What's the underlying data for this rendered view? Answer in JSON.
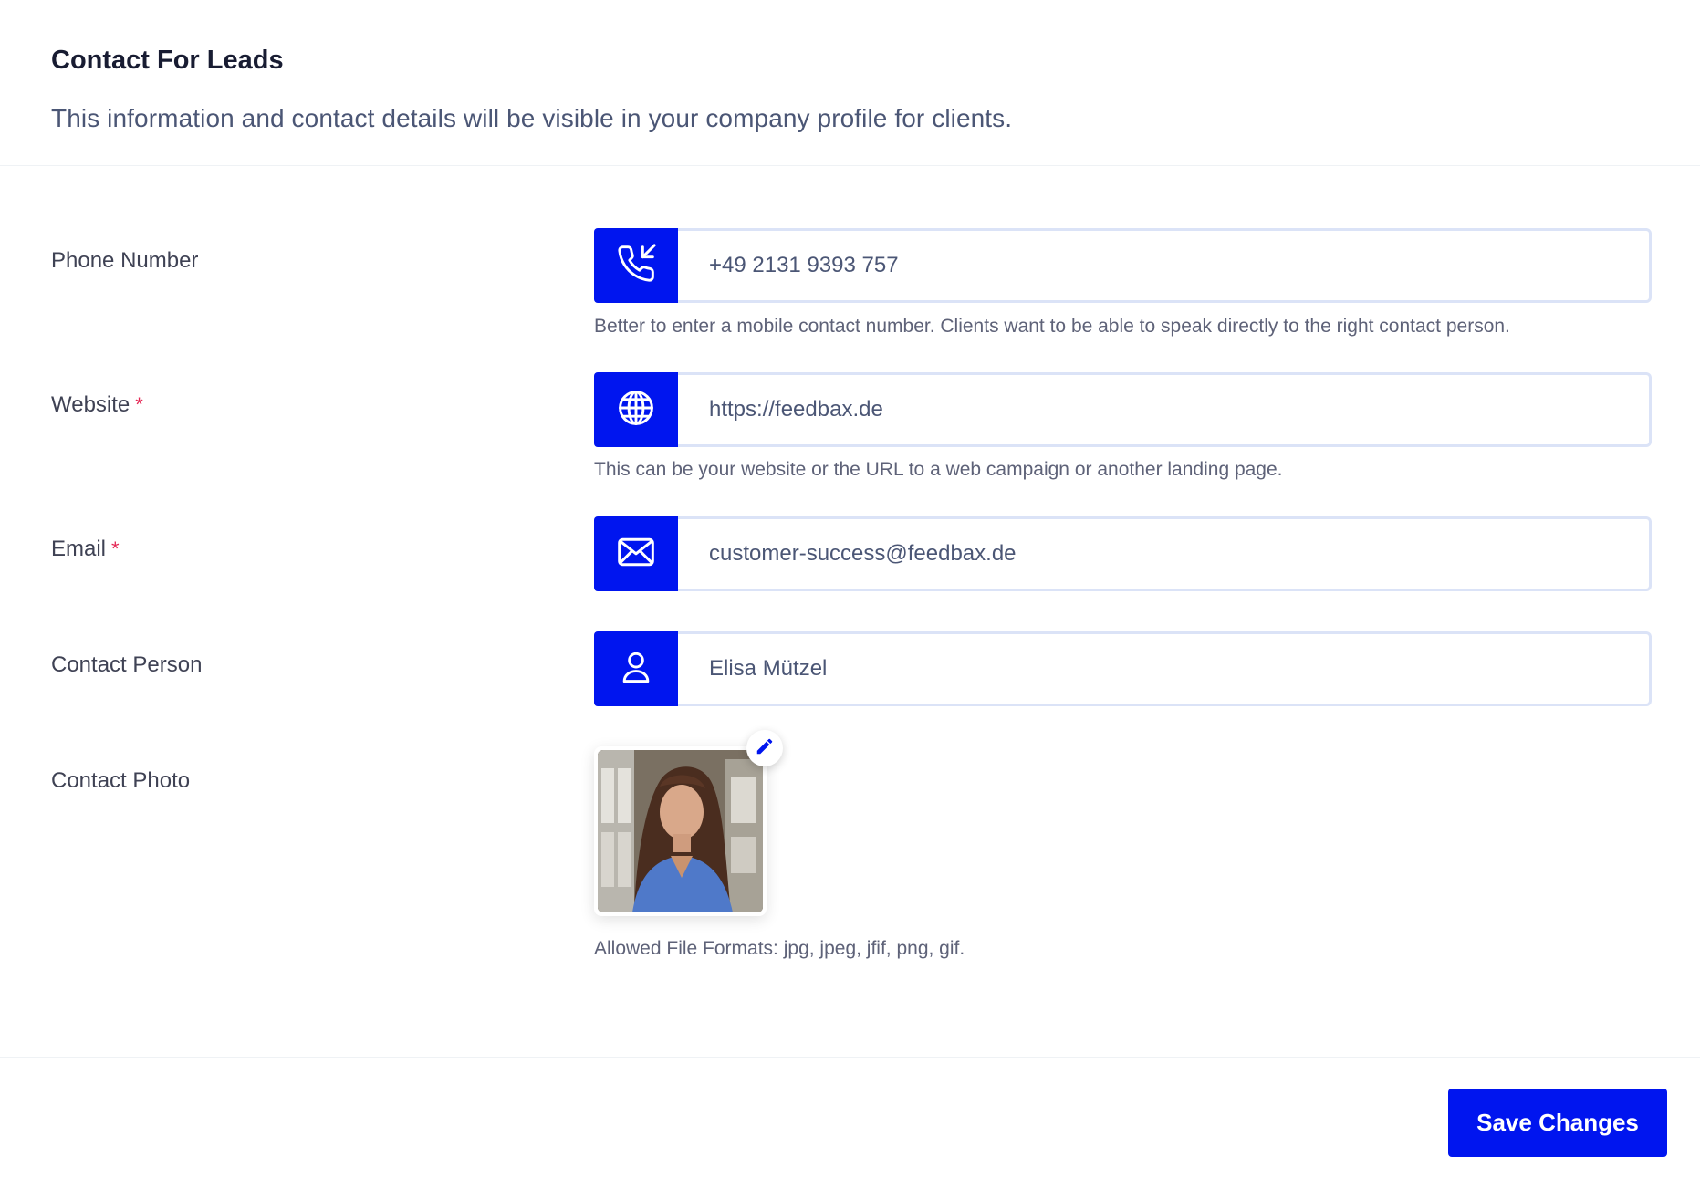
{
  "header": {
    "title": "Contact For Leads",
    "subtitle": "This information and contact details will be visible in your company profile for clients."
  },
  "fields": {
    "phone": {
      "label": "Phone Number",
      "value": "+49 2131 9393 757",
      "help": "Better to enter a mobile contact number. Clients want to be able to speak directly to the right contact person.",
      "icon": "phone-incoming-icon"
    },
    "website": {
      "label": "Website",
      "required_mark": "*",
      "value": "https://feedbax.de",
      "help": "This can be your website or the URL to a web campaign or another landing page.",
      "icon": "globe-icon"
    },
    "email": {
      "label": "Email",
      "required_mark": "*",
      "value": "customer-success@feedbax.de",
      "icon": "envelope-icon"
    },
    "contact_person": {
      "label": "Contact Person",
      "value": "Elisa Mützel",
      "icon": "user-icon"
    },
    "contact_photo": {
      "label": "Contact Photo",
      "help": "Allowed File Formats: jpg, jpeg, jfif, png, gif.",
      "edit_icon": "pencil-icon"
    }
  },
  "footer": {
    "save_label": "Save Changes"
  },
  "colors": {
    "primary": "#0015ef",
    "required": "#e42855",
    "input_border": "#dbe3f7",
    "title": "#181c32",
    "text": "#4b5675"
  }
}
